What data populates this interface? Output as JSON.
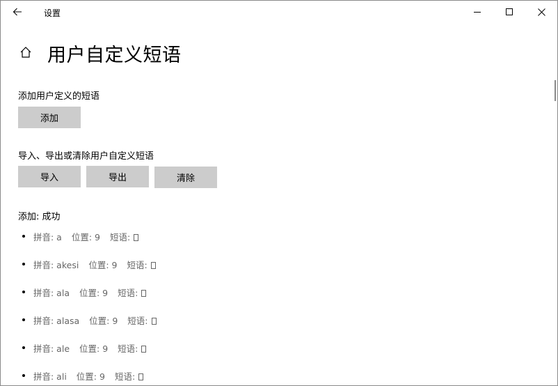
{
  "window": {
    "title": "设置"
  },
  "page": {
    "title": "用户自定义短语"
  },
  "add_section": {
    "label": "添加用户定义的短语",
    "add_button": "添加"
  },
  "manage_section": {
    "label": "导入、导出或清除用户自定义短语",
    "import_button": "导入",
    "export_button": "导出",
    "clear_button": "清除"
  },
  "status_text": "添加: 成功",
  "phrases": [
    {
      "pinyin": "拼音: a",
      "position": "位置: 9",
      "phrase": "短语:"
    },
    {
      "pinyin": "拼音: akesi",
      "position": "位置: 9",
      "phrase": "短语:"
    },
    {
      "pinyin": "拼音: ala",
      "position": "位置: 9",
      "phrase": "短语:"
    },
    {
      "pinyin": "拼音: alasa",
      "position": "位置: 9",
      "phrase": "短语:"
    },
    {
      "pinyin": "拼音: ale",
      "position": "位置: 9",
      "phrase": "短语:"
    },
    {
      "pinyin": "拼音: ali",
      "position": "位置: 9",
      "phrase": "短语:"
    }
  ],
  "icons": {
    "back": "arrow-left-icon",
    "home": "home-icon",
    "minimize": "minimize-icon",
    "maximize": "maximize-icon",
    "close": "close-icon",
    "missing_glyph": "tofu-box-icon"
  },
  "colors": {
    "button_bg": "#cccccc",
    "secondary_text": "#666666"
  }
}
